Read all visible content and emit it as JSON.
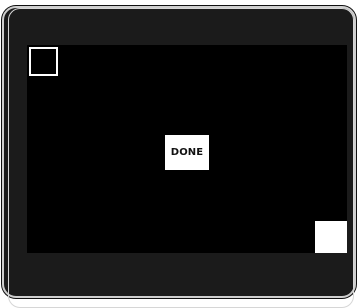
{
  "screen": {
    "button_label": "DONE"
  },
  "colors": {
    "background": "#000000",
    "bezel": "#1b1b1b",
    "accent": "#ffffff"
  },
  "icons": {
    "top_left": "calibration-target-outline-icon",
    "bottom_right": "calibration-target-filled-icon"
  }
}
